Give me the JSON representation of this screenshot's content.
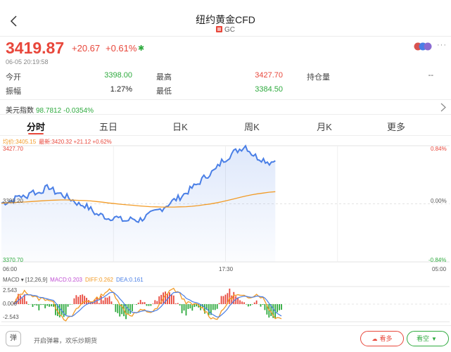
{
  "header": {
    "title": "纽约黄金CFD",
    "code": "GC"
  },
  "quote": {
    "price": "3419.87",
    "change": "+20.67",
    "change_pct": "+0.61%",
    "timestamp": "06-05 20:19:58",
    "more": "···"
  },
  "stats": {
    "open_label": "今开",
    "open_value": "3398.00",
    "high_label": "最高",
    "high_value": "3427.70",
    "oi_label": "持仓量",
    "oi_value": "--",
    "amp_label": "振幅",
    "amp_value": "1.27%",
    "low_label": "最低",
    "low_value": "3384.50"
  },
  "usd_index": {
    "label": "美元指数",
    "value": "98.7812",
    "change": "-0.0354%"
  },
  "tabs": [
    "分时",
    "五日",
    "日K",
    "周K",
    "月K",
    "更多"
  ],
  "chart_info": {
    "avg": "均价:3405.15",
    "last": "最新:3420.32 +21.12 +0.62%"
  },
  "axis": {
    "y_top": "3427.70",
    "y_mid": "3399.20",
    "y_bot": "3370.70",
    "pct_top": "0.84%",
    "pct_mid": "0.00%",
    "pct_bot": "-0.84%",
    "x_start": "06:00",
    "x_mid": "17:30",
    "x_end": "05:00"
  },
  "macd": {
    "title": "MACD",
    "params": "[12,26,9]",
    "macd": "MACD:0.203",
    "diff": "DIFF:0.262",
    "dea": "DEA:0.161",
    "y_top": "2.543",
    "y_mid": "0.000",
    "y_bot": "-2.543"
  },
  "bottom": {
    "bullet_icon": "弹",
    "bullet_text": "开启弹幕，欢乐炒期货",
    "long_label": "看多",
    "short_label": "看空"
  },
  "chart_data": {
    "type": "line",
    "series": [
      {
        "name": "最新",
        "values": [
          3399.5,
          3400.2,
          3401.0,
          3403.5,
          3402.0,
          3405.8,
          3404.2,
          3406.0,
          3407.5,
          3405.0,
          3404.0,
          3402.5,
          3401.0,
          3399.0,
          3398.5,
          3396.5,
          3394.0,
          3393.5,
          3392.0,
          3393.0,
          3391.5,
          3390.8,
          3392.0,
          3391.0,
          3392.5,
          3394.0,
          3395.5,
          3397.0,
          3399.0,
          3401.0,
          3402.5,
          3404.5,
          3407.0,
          3409.0,
          3412.0,
          3414.0,
          3416.0,
          3420.0,
          3422.0,
          3424.5,
          3426.0,
          3427.7,
          3424.0,
          3422.0,
          3421.0,
          3419.5,
          3420.3
        ]
      },
      {
        "name": "均价",
        "values": [
          3399.5,
          3399.7,
          3399.8,
          3400.0,
          3400.1,
          3400.3,
          3400.5,
          3400.7,
          3400.9,
          3401.0,
          3401.1,
          3401.1,
          3401.0,
          3400.9,
          3400.8,
          3400.6,
          3400.3,
          3400.0,
          3399.6,
          3399.3,
          3399.0,
          3398.7,
          3398.5,
          3398.2,
          3398.0,
          3397.8,
          3397.7,
          3397.6,
          3397.6,
          3397.6,
          3397.7,
          3397.8,
          3398.0,
          3398.3,
          3398.7,
          3399.1,
          3399.6,
          3400.2,
          3400.9,
          3401.6,
          3402.3,
          3403.0,
          3403.6,
          3404.1,
          3404.5,
          3404.9,
          3405.15
        ]
      }
    ],
    "ylim": [
      3370.7,
      3427.7
    ]
  }
}
